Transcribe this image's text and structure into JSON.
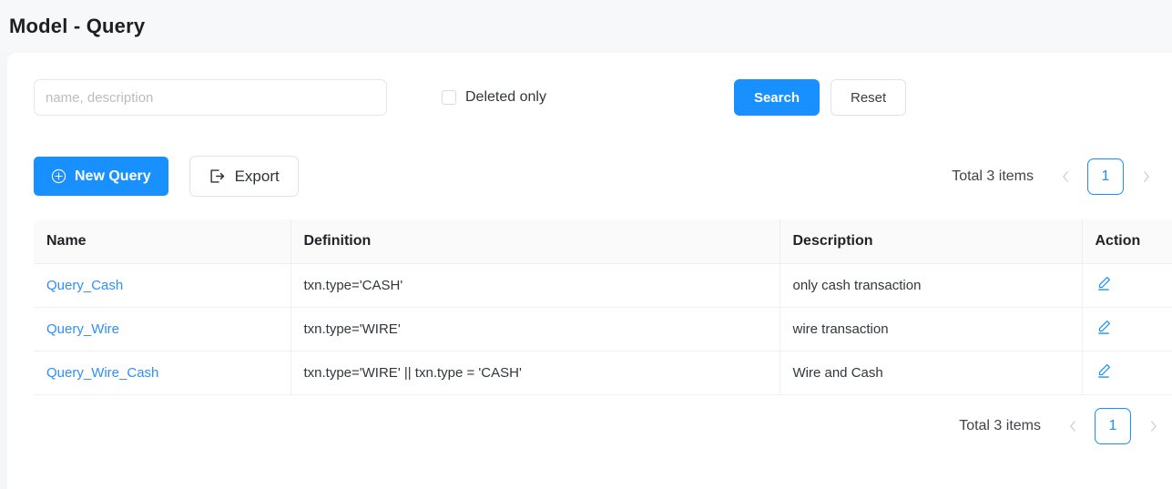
{
  "header": {
    "title": "Model - Query"
  },
  "filters": {
    "search_placeholder": "name, description",
    "search_value": "",
    "deleted_only_label": "Deleted only",
    "deleted_only_checked": false,
    "search_button": "Search",
    "reset_button": "Reset"
  },
  "toolbar": {
    "new_query_label": "New Query",
    "new_query_icon": "plus-circle-icon",
    "export_label": "Export",
    "export_icon": "export-icon"
  },
  "pagination": {
    "total_label": "Total 3 items",
    "prev_icon": "chevron-left-icon",
    "next_icon": "chevron-right-icon",
    "current_page": "1"
  },
  "table": {
    "columns": [
      "Name",
      "Definition",
      "Description",
      "Action"
    ],
    "rows": [
      {
        "name": "Query_Cash",
        "definition": "txn.type='CASH'",
        "description": "only cash transaction",
        "action_icon": "edit-pencil-icon"
      },
      {
        "name": "Query_Wire",
        "definition": "txn.type='WIRE'",
        "description": "wire transaction",
        "action_icon": "edit-pencil-icon"
      },
      {
        "name": "Query_Wire_Cash",
        "definition": "txn.type='WIRE' || txn.type = 'CASH'",
        "description": "Wire and Cash",
        "action_icon": "edit-pencil-icon"
      }
    ]
  },
  "colors": {
    "primary": "#1890ff",
    "link": "#2f8ff5",
    "page_bg": "#f5f6f7",
    "header_bg": "#f7f8f9",
    "table_header_bg": "#fafafa"
  }
}
